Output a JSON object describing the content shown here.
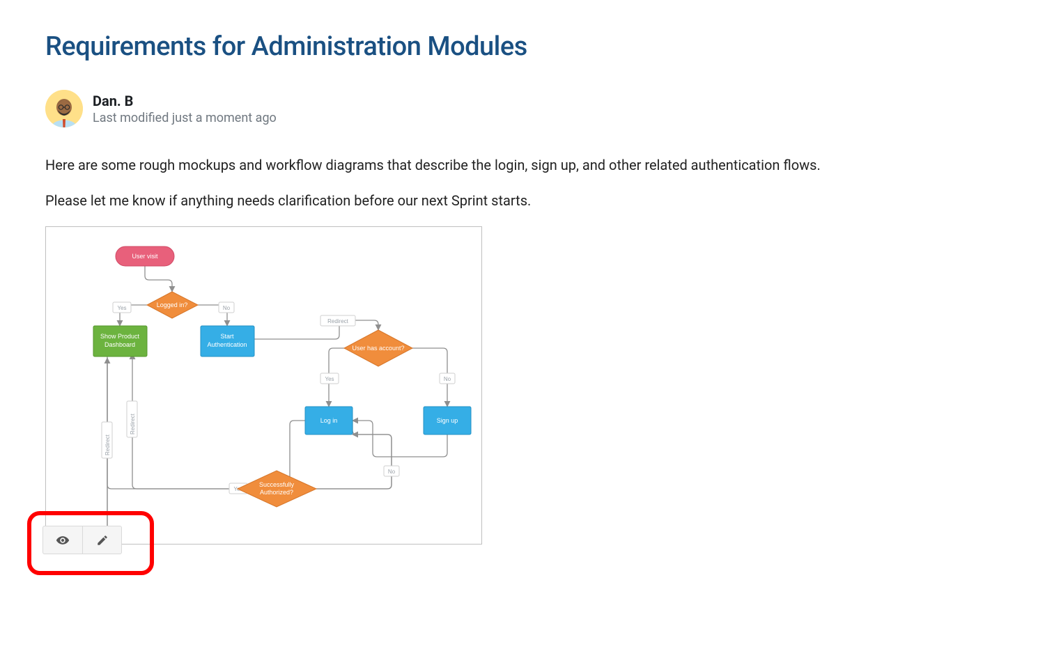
{
  "page": {
    "title": "Requirements for Administration Modules",
    "author": {
      "name": "Dan. B",
      "modified_text": "Last modified just a moment ago"
    },
    "body": {
      "paragraph1": "Here are some rough mockups and workflow diagrams that describe the login, sign up, and other related authentication flows.",
      "paragraph2": "Please let me know if anything needs clarification before our next Sprint starts."
    }
  },
  "flowchart": {
    "nodes": {
      "user_visit": "User visit",
      "logged_in": "Logged in?",
      "show_product_dashboard_l1": "Show Product",
      "show_product_dashboard_l2": "Dashboard",
      "start_auth_l1": "Start",
      "start_auth_l2": "Authentication",
      "user_has_account": "User has account?",
      "log_in": "Log in",
      "sign_up": "Sign up",
      "successfully_authorized_l1": "Successfully",
      "successfully_authorized_l2": "Authorized?"
    },
    "edge_labels": {
      "yes": "Yes",
      "no": "No",
      "redirect": "Redirect"
    }
  },
  "toolbar": {
    "view_button": "View",
    "edit_button": "Edit"
  }
}
